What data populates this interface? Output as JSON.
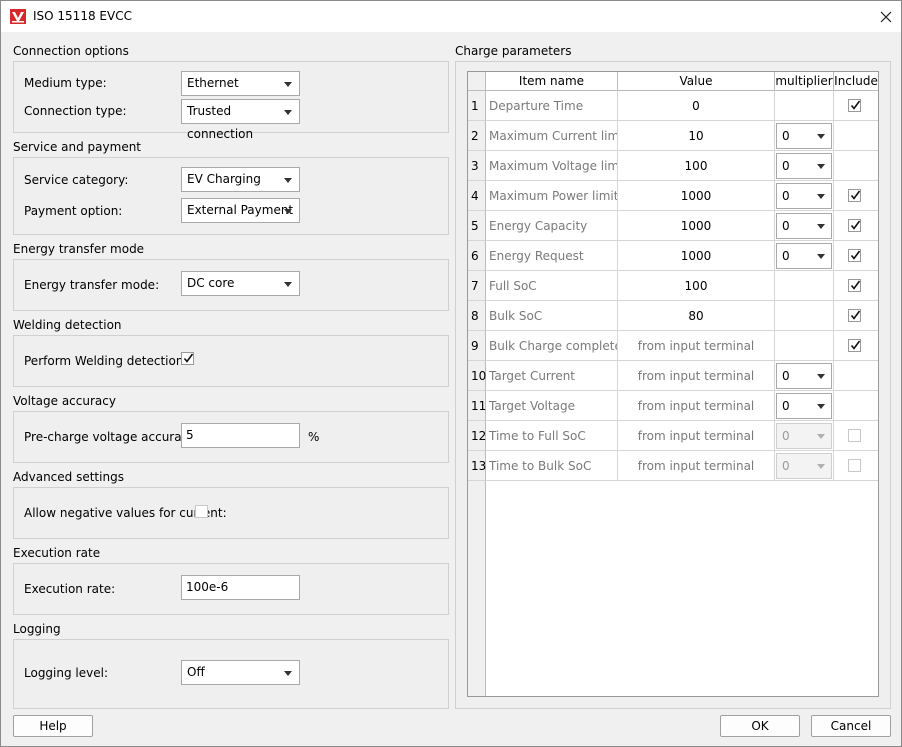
{
  "window": {
    "title": "ISO 15118 EVCC"
  },
  "connection_options": {
    "title": "Connection options",
    "medium_type": {
      "label": "Medium type:",
      "value": "Ethernet"
    },
    "connection_type": {
      "label": "Connection type:",
      "value": "Trusted connection"
    }
  },
  "service_payment": {
    "title": "Service and payment",
    "service_category": {
      "label": "Service category:",
      "value": "EV Charging"
    },
    "payment_option": {
      "label": "Payment option:",
      "value": "External Payment"
    }
  },
  "energy_transfer": {
    "title": "Energy transfer mode",
    "mode": {
      "label": "Energy transfer mode:",
      "value": "DC core"
    }
  },
  "welding": {
    "title": "Welding detection",
    "perform": {
      "label": "Perform Welding detection:",
      "checked": true
    }
  },
  "voltage_accuracy": {
    "title": "Voltage accuracy",
    "precharge": {
      "label": "Pre-charge voltage accuracy:",
      "value": "5",
      "unit": "%"
    }
  },
  "advanced": {
    "title": "Advanced settings",
    "allow_negative": {
      "label": "Allow negative values for current:",
      "checked": false
    }
  },
  "execution": {
    "title": "Execution rate",
    "rate": {
      "label": "Execution rate:",
      "value": "100e-6"
    }
  },
  "logging": {
    "title": "Logging",
    "level": {
      "label": "Logging level:",
      "value": "Off"
    }
  },
  "charge_params": {
    "title": "Charge parameters",
    "headers": {
      "item_name": "Item name",
      "value": "Value",
      "multiplier": "multiplier",
      "include": "Include"
    },
    "rows": [
      {
        "num": "1",
        "name": "Departure Time",
        "value": "0",
        "multiplier": null,
        "include": true
      },
      {
        "num": "2",
        "name": "Maximum Current limit",
        "value": "10",
        "multiplier": "0",
        "include": null
      },
      {
        "num": "3",
        "name": "Maximum Voltage limit",
        "value": "100",
        "multiplier": "0",
        "include": null
      },
      {
        "num": "4",
        "name": "Maximum Power limit",
        "value": "1000",
        "multiplier": "0",
        "include": true
      },
      {
        "num": "5",
        "name": "Energy Capacity",
        "value": "1000",
        "multiplier": "0",
        "include": true
      },
      {
        "num": "6",
        "name": "Energy Request",
        "value": "1000",
        "multiplier": "0",
        "include": true
      },
      {
        "num": "7",
        "name": "Full SoC",
        "value": "100",
        "multiplier": null,
        "include": true
      },
      {
        "num": "8",
        "name": "Bulk SoC",
        "value": "80",
        "multiplier": null,
        "include": true
      },
      {
        "num": "9",
        "name": "Bulk Charge complete",
        "value": "from input terminal",
        "multiplier": null,
        "include": true
      },
      {
        "num": "10",
        "name": "Target Current",
        "value": "from input terminal",
        "multiplier": "0",
        "include": null
      },
      {
        "num": "11",
        "name": "Target Voltage",
        "value": "from input terminal",
        "multiplier": "0",
        "include": null
      },
      {
        "num": "12",
        "name": "Time to Full SoC",
        "value": "from input terminal",
        "multiplier": "0",
        "multiplier_disabled": true,
        "include": false,
        "include_disabled": true
      },
      {
        "num": "13",
        "name": "Time to Bulk SoC",
        "value": "from input terminal",
        "multiplier": "0",
        "multiplier_disabled": true,
        "include": false,
        "include_disabled": true
      }
    ]
  },
  "buttons": {
    "help": "Help",
    "ok": "OK",
    "cancel": "Cancel"
  },
  "icons": {
    "app": "vector-logo-icon",
    "close": "close-icon"
  },
  "colors": {
    "app_icon": "#d42a2a"
  }
}
